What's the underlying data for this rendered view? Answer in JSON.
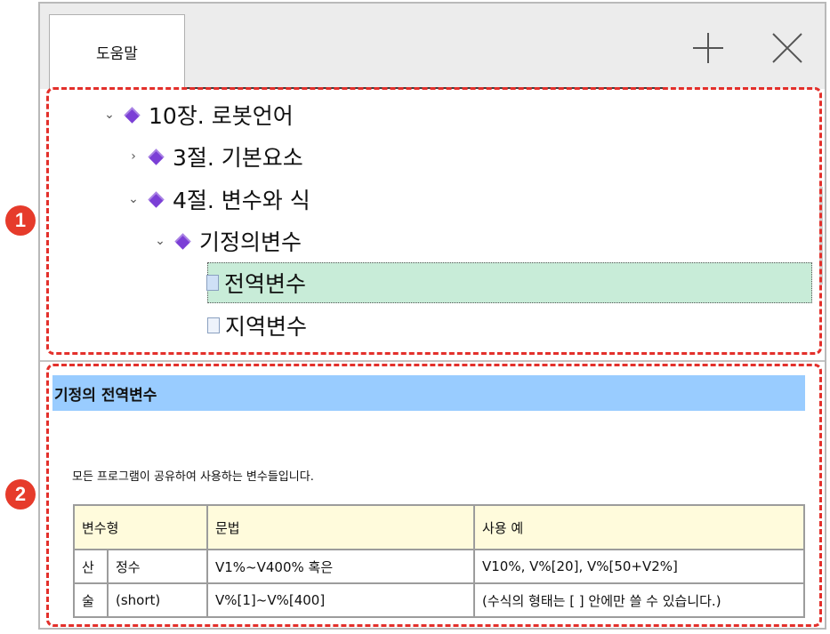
{
  "tab": {
    "label": "도움말",
    "new_tab_icon": "plus-icon",
    "close_icon": "close-icon"
  },
  "tree": {
    "nodes": [
      {
        "label": "10장. 로봇언어",
        "icon": "book-icon",
        "toggle": "⌄"
      },
      {
        "label": "3절. 기본요소",
        "icon": "book-icon",
        "toggle": "›"
      },
      {
        "label": "4절. 변수와 식",
        "icon": "book-icon",
        "toggle": "⌄"
      },
      {
        "label": "기정의변수",
        "icon": "book-icon",
        "toggle": "⌄"
      },
      {
        "label": "전역변수",
        "icon": "page-icon",
        "selected": true
      },
      {
        "label": "지역변수",
        "icon": "page-icon"
      }
    ]
  },
  "help": {
    "title": "기정의 전역변수",
    "description": "모든 프로그램이 공유하여 사용하는 변수들입니다.",
    "table": {
      "headers": [
        "변수형",
        "문법",
        "사용 예"
      ],
      "rows": [
        [
          "산",
          "정수",
          "V1%~V400% 혹은",
          "V10%, V%[20], V%[50+V2%]"
        ],
        [
          "술",
          "(short)",
          "V%[1]~V%[400]",
          "(수식의 형태는 [ ] 안에만 쓸 수 있습니다.)"
        ]
      ]
    }
  },
  "callouts": [
    {
      "number": "1"
    },
    {
      "number": "2"
    }
  ],
  "colors": {
    "accent": "#e3302b",
    "selection": "#c8ecd8",
    "title_bar": "#99ccff",
    "header_bg": "#fffbdc",
    "book_icon": "#7b3fd6"
  }
}
